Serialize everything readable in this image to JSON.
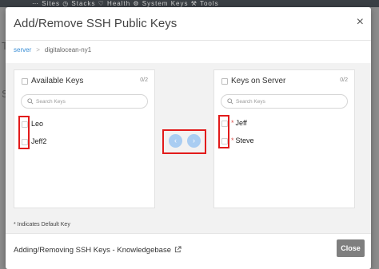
{
  "background": {
    "nav_text": "⋯ Sites  ◷ Stacks  ♡ Health  ⚙ System Keys  ⚒ Tools",
    "fragment_a": "T",
    "fragment_b": "S"
  },
  "modal": {
    "title": "Add/Remove SSH Public Keys",
    "close_glyph": "×"
  },
  "breadcrumb": {
    "parent": "server",
    "separator": ">",
    "current": "digitalocean-ny1"
  },
  "available_panel": {
    "title": "Available Keys",
    "count": "0/2",
    "search_placeholder": "Search Keys",
    "items": [
      {
        "label": "Leo",
        "default": false
      },
      {
        "label": "Jeff2",
        "default": false
      }
    ]
  },
  "server_panel": {
    "title": "Keys on Server",
    "count": "0/2",
    "search_placeholder": "Search Keys",
    "items": [
      {
        "label": "Jeff",
        "default": true,
        "star": "*"
      },
      {
        "label": "Steve",
        "default": true,
        "star": "*"
      }
    ]
  },
  "transfer": {
    "move_left_glyph": "‹",
    "move_right_glyph": "›"
  },
  "note": "* Indicates Default Key",
  "footer": {
    "kb_link": "Adding/Removing SSH Keys - Knowledgebase",
    "close_label": "Close"
  },
  "colors": {
    "accent": "#3b8fd6",
    "transfer_button": "#a9cdf2",
    "highlight": "#e21b1b",
    "close_button": "#7f7f7f",
    "default_star": "#d9534f"
  },
  "icons": {
    "search": "search-icon",
    "external_link": "external-link-icon",
    "close": "close-icon"
  }
}
